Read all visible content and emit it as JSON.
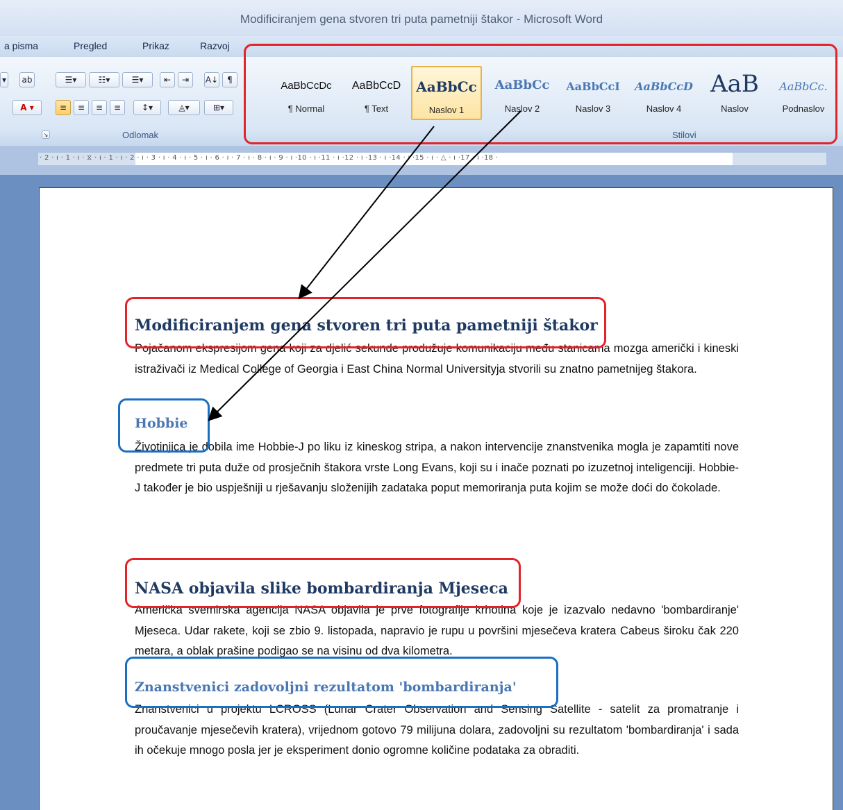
{
  "window": {
    "title": "Modificiranjem gena stvoren tri puta pametniji štakor - Microsoft Word"
  },
  "menu": {
    "items": [
      "a pisma",
      "Pregled",
      "Prikaz",
      "Razvoj"
    ]
  },
  "ribbon": {
    "paragraph_group_label": "Odlomak",
    "styles_group_label": "Stilovi",
    "styles": [
      {
        "preview": "AaBbCcDc",
        "name": "¶ Normal"
      },
      {
        "preview": "AaBbCcD",
        "name": "¶ Text"
      },
      {
        "preview": "AaBbCc",
        "name": "Naslov 1"
      },
      {
        "preview": "AaBbCc",
        "name": "Naslov 2"
      },
      {
        "preview": "AaBbCcI",
        "name": "Naslov 3"
      },
      {
        "preview": "AaBbCcD",
        "name": "Naslov 4"
      },
      {
        "preview": "AaB",
        "name": "Naslov"
      },
      {
        "preview": "AaBbCc.",
        "name": "Podnaslov"
      }
    ],
    "selected_style": "Naslov 1"
  },
  "ruler": {
    "text": "· 2 · ı · 1 · ı · ⧖ · ı · 1 · ı · 2 · ı · 3 · ı · 4 · ı · 5 · ı · 6 · ı · 7 · ı · 8 · ı · 9 · ı ·10 · ı ·11 · ı ·12 · ı ·13 · ı ·14 · ı ·15 · ı · △ · ı ·17 · ı ·18 ·"
  },
  "document": {
    "heading1_a": "Modificiranjem gena stvoren tri puta pametniji štakor",
    "para1": "Pojačanom ekspresijom gena koji za djelić sekunde produžuje komunikaciju među stanicama mozga američki i kineski istraživači iz Medical College of Georgia i East China Normal Universityja stvorili su znatno pametnijeg štakora.",
    "heading2_a": "Hobbie",
    "para2": "Životinjica je dobila ime Hobbie-J po liku iz kineskog stripa, a nakon intervencije znanstvenika mogla je zapamtiti nove predmete tri puta duže od prosječnih štakora vrste Long Evans, koji su i inače poznati po izuzetnoj inteligenciji. Hobbie-J također je bio uspješniji u rješavanju složenijih zadataka poput memoriranja puta kojim se može doći do čokolade.",
    "heading1_b": "NASA objavila slike bombardiranja Mjeseca",
    "para3": "Američka svemirska agencija NASA objavila je prve fotografije krhotina koje je izazvalo nedavno 'bombardiranje' Mjeseca. Udar rakete, koji se zbio 9. listopada, napravio je rupu u površini mjesečeva kratera Cabeus široku čak 220 metara, a oblak prašine podigao se na visinu od dva kilometra.",
    "heading2_b": "Znanstvenici zadovoljni rezultatom 'bombardiranja'",
    "para4": "Znanstvenici u projektu LCROSS (Lunar Crater Observation and Sensing Satellite - satelit za promatranje i proučavanje mjesečevih kratera), vrijednom gotovo 79 milijuna dolara, zadovoljni su rezultatom 'bombardiranja' i sada ih očekuje mnogo posla jer je eksperiment donio ogromne količine podataka za obraditi."
  },
  "annotation_colors": {
    "heading1_box": "#e3232a",
    "heading2_box": "#1a6fc1",
    "arrow": "#000000"
  }
}
